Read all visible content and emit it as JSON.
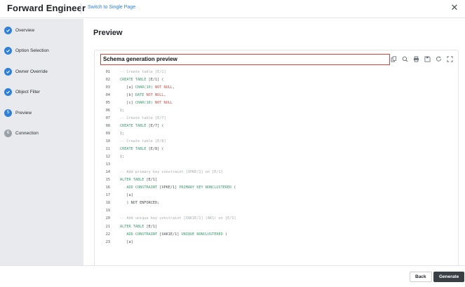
{
  "header": {
    "title": "Forward Engineer",
    "switch_link": "Switch to Single Page",
    "close_glyph": "✕"
  },
  "sidebar": {
    "steps": [
      {
        "label": "Overview",
        "state": "done"
      },
      {
        "label": "Option Selection",
        "state": "done"
      },
      {
        "label": "Owner Override",
        "state": "done"
      },
      {
        "label": "Object Filter",
        "state": "done"
      },
      {
        "label": "Preview",
        "state": "current",
        "number": "5"
      },
      {
        "label": "Connection",
        "state": "todo",
        "number": "6"
      }
    ]
  },
  "main": {
    "title": "Preview",
    "preview": {
      "title": "Schema generation preview",
      "toolbar_icons": [
        "copy-icon",
        "search-icon",
        "print-icon",
        "save-icon",
        "refresh-icon",
        "fullscreen-icon"
      ]
    }
  },
  "code_lines": [
    {
      "n": "01",
      "tokens": [
        {
          "t": "-- Create table [E/1]",
          "c": "cm"
        }
      ]
    },
    {
      "n": "02",
      "tokens": [
        {
          "t": "CREATE TABLE ",
          "c": "kw"
        },
        {
          "t": "[E/1] (",
          "c": "id"
        }
      ]
    },
    {
      "n": "03",
      "tokens": [
        {
          "t": "   [a] ",
          "c": "id"
        },
        {
          "t": "CHAR(10) ",
          "c": "kw"
        },
        {
          "t": "NOT NULL",
          "c": "type"
        },
        {
          "t": ",",
          "c": "id"
        }
      ]
    },
    {
      "n": "04",
      "tokens": [
        {
          "t": "   [b] ",
          "c": "id"
        },
        {
          "t": "DATE ",
          "c": "kw"
        },
        {
          "t": "NOT NULL",
          "c": "type"
        },
        {
          "t": ",",
          "c": "id"
        }
      ]
    },
    {
      "n": "05",
      "tokens": [
        {
          "t": "   [c] ",
          "c": "id"
        },
        {
          "t": "CHAR(18) ",
          "c": "kw"
        },
        {
          "t": "NOT NULL",
          "c": "type"
        }
      ]
    },
    {
      "n": "06",
      "tokens": [
        {
          "t": ");",
          "c": "id"
        }
      ]
    },
    {
      "n": "07",
      "tokens": [
        {
          "t": "-- Create table [E/7]",
          "c": "cm"
        }
      ]
    },
    {
      "n": "08",
      "tokens": [
        {
          "t": "CREATE TABLE ",
          "c": "kw"
        },
        {
          "t": "[E/7] (",
          "c": "id"
        }
      ]
    },
    {
      "n": "09",
      "tokens": [
        {
          "t": ");",
          "c": "id"
        }
      ]
    },
    {
      "n": "10",
      "tokens": [
        {
          "t": "-- Create table [E/8]",
          "c": "cm"
        }
      ]
    },
    {
      "n": "11",
      "tokens": [
        {
          "t": "CREATE TABLE ",
          "c": "kw"
        },
        {
          "t": "[E/8] (",
          "c": "id"
        }
      ]
    },
    {
      "n": "12",
      "tokens": [
        {
          "t": ");",
          "c": "id"
        }
      ]
    },
    {
      "n": "13",
      "tokens": []
    },
    {
      "n": "14",
      "tokens": [
        {
          "t": "-- Add primary key constraint [XPKE/1] on [E/1]",
          "c": "cm"
        }
      ]
    },
    {
      "n": "15",
      "tokens": [
        {
          "t": "ALTER TABLE ",
          "c": "kw"
        },
        {
          "t": "[E/1]",
          "c": "id"
        }
      ]
    },
    {
      "n": "16",
      "tokens": [
        {
          "t": "   ADD CONSTRAINT ",
          "c": "kw"
        },
        {
          "t": "[XPKE/1] ",
          "c": "id"
        },
        {
          "t": "PRIMARY KEY NONCLUSTERED ",
          "c": "kw"
        },
        {
          "t": "(",
          "c": "id"
        }
      ]
    },
    {
      "n": "17",
      "tokens": [
        {
          "t": "   [a]",
          "c": "id"
        }
      ]
    },
    {
      "n": "18",
      "tokens": [
        {
          "t": "   ) NOT ENFORCED;",
          "c": "id"
        }
      ]
    },
    {
      "n": "19",
      "tokens": []
    },
    {
      "n": "20",
      "tokens": [
        {
          "t": "-- Add unique key constraint [XAK1E/1] (AK1) on [E/1]",
          "c": "cm"
        }
      ]
    },
    {
      "n": "21",
      "tokens": [
        {
          "t": "ALTER TABLE ",
          "c": "kw"
        },
        {
          "t": "[E/1]",
          "c": "id"
        }
      ]
    },
    {
      "n": "22",
      "tokens": [
        {
          "t": "   ADD CONSTRAINT ",
          "c": "kw"
        },
        {
          "t": "[XAK1E/1] ",
          "c": "id"
        },
        {
          "t": "UNIQUE NONCLUSTERED ",
          "c": "kw"
        },
        {
          "t": "(",
          "c": "id"
        }
      ]
    },
    {
      "n": "23",
      "tokens": [
        {
          "t": "   [a]",
          "c": "id"
        }
      ]
    }
  ],
  "footer": {
    "back_label": "Back",
    "generate_label": "Generate"
  },
  "colors": {
    "accent": "#2f80d8",
    "highlight_border": "#d9443a",
    "keyword": "#3c9a6e",
    "constraint": "#c2544f",
    "comment": "#a5abb2"
  }
}
